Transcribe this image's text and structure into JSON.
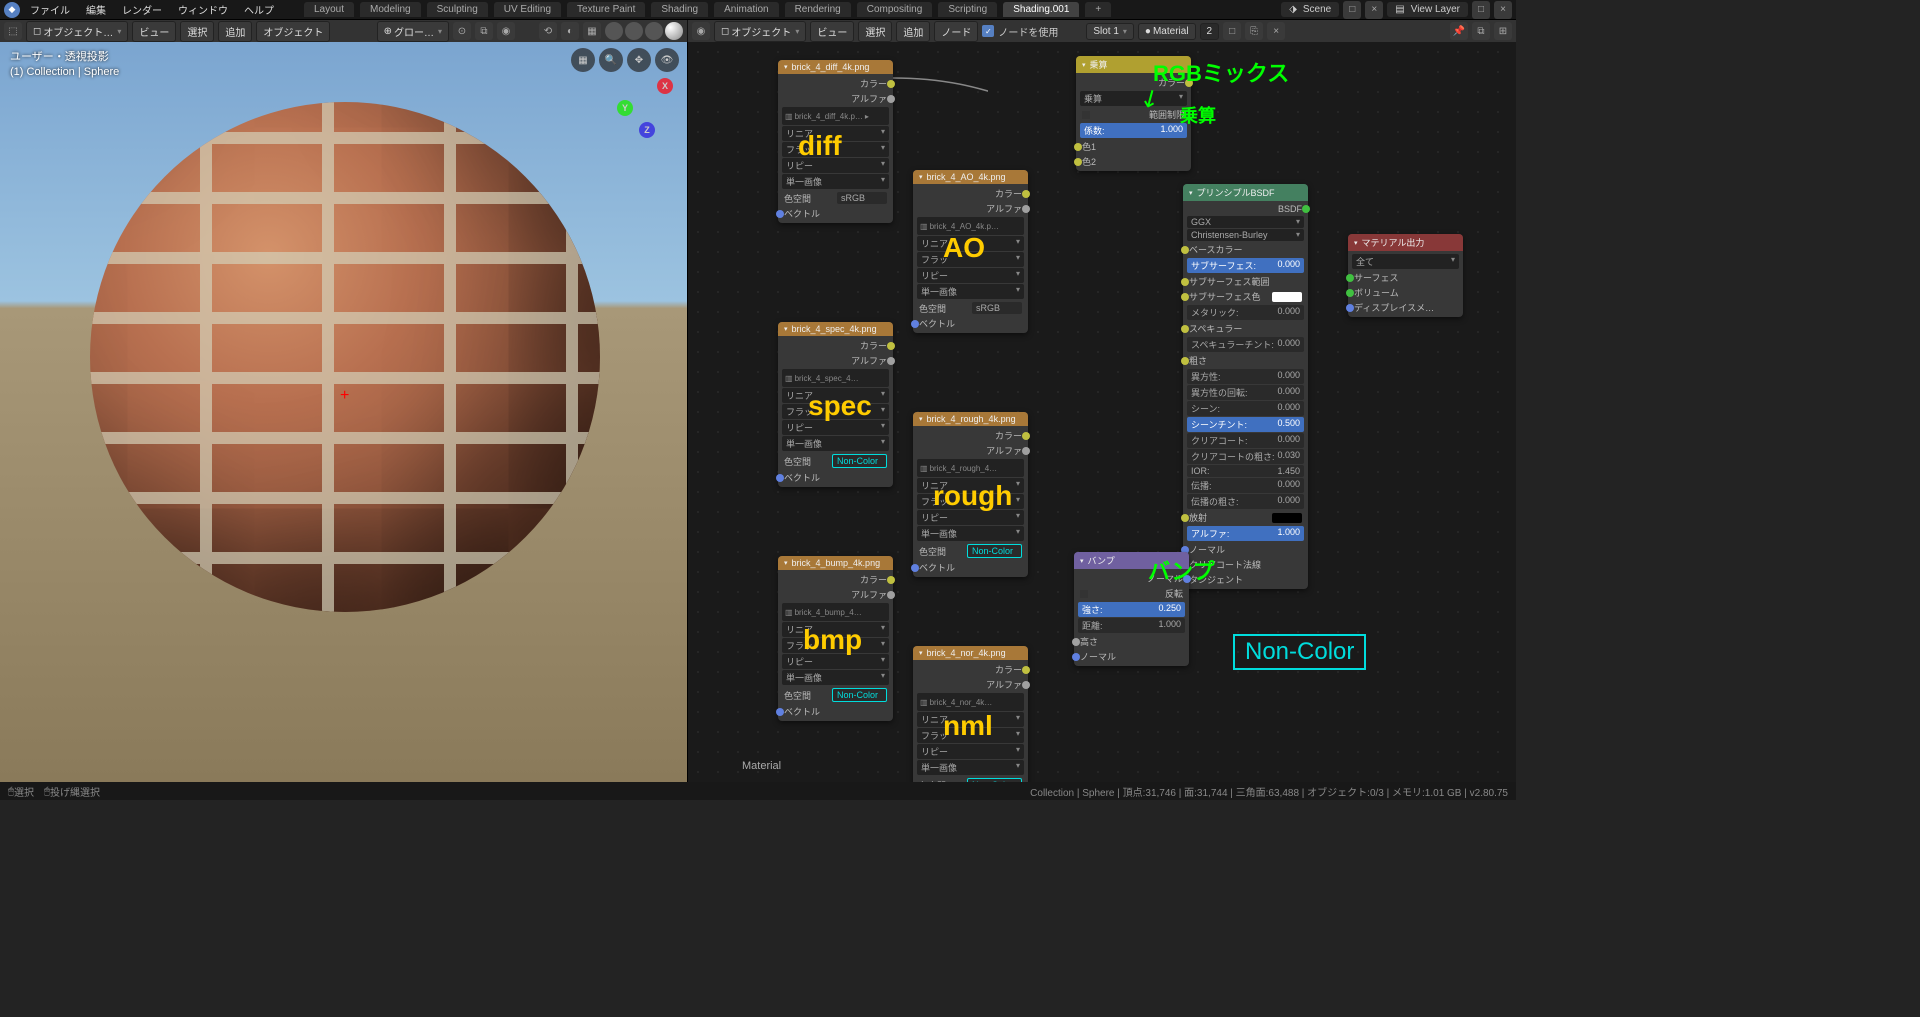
{
  "topbar": {
    "menus": [
      "ファイル",
      "編集",
      "レンダー",
      "ウィンドウ",
      "ヘルプ"
    ],
    "tabs": [
      "Layout",
      "Modeling",
      "Sculpting",
      "UV Editing",
      "Texture Paint",
      "Shading",
      "Animation",
      "Rendering",
      "Compositing",
      "Scripting",
      "Shading.001"
    ],
    "active_tab": "Shading.001",
    "scene_label": "Scene",
    "viewlayer_label": "View Layer"
  },
  "header_left": {
    "mode": "オブジェクト…",
    "menus": [
      "ビュー",
      "選択",
      "追加",
      "オブジェクト"
    ],
    "orient": "グロー…"
  },
  "header_right": {
    "mode": "オブジェクト",
    "menus": [
      "ビュー",
      "選択",
      "追加",
      "ノード"
    ],
    "use_nodes": "ノードを使用",
    "slot": "Slot 1",
    "material": "Material",
    "mat_users": "2"
  },
  "viewport": {
    "line1": "ユーザー・透視投影",
    "line2": "(1) Collection | Sphere"
  },
  "nodes": {
    "diff": {
      "title": "brick_4_diff_4k.png",
      "file": "brick_4_diff_4k.p…",
      "out_color": "カラー",
      "out_alpha": "アルファ",
      "interp": "リニア",
      "proj": "フラッ",
      "ext": "リピー",
      "single": "単一画像",
      "cs_label": "色空間",
      "cs": "sRGB",
      "vec": "ベクトル"
    },
    "ao": {
      "title": "brick_4_AO_4k.png",
      "file": "brick_4_AO_4k.p…",
      "cs": "sRGB"
    },
    "spec": {
      "title": "brick_4_spec_4k.png",
      "file": "brick_4_spec_4…",
      "cs": "Non-Color"
    },
    "rough": {
      "title": "brick_4_rough_4k.png",
      "file": "brick_4_rough_4…",
      "cs": "Non-Color"
    },
    "bmp": {
      "title": "brick_4_bump_4k.png",
      "file": "brick_4_bump_4…",
      "cs": "Non-Color"
    },
    "nml": {
      "title": "brick_4_nor_4k.png",
      "file": "brick_4_nor_4k…",
      "cs": "Non-Color"
    },
    "mix": {
      "title": "乗算",
      "out": "カラー",
      "blend": "乗算",
      "clamp": "範囲制限",
      "fac_l": "係数:",
      "fac": "1.000",
      "c1": "色1",
      "c2": "色2"
    },
    "bsdf": {
      "title": "プリンシプルBSDF",
      "out": "BSDF",
      "dist": "GGX",
      "sss": "Christensen-Burley",
      "rows": [
        [
          "ベースカラー",
          ""
        ],
        [
          "サブサーフェス:",
          "0.000"
        ],
        [
          "サブサーフェス範囲",
          ""
        ],
        [
          "サブサーフェス色",
          ""
        ],
        [
          "メタリック:",
          "0.000"
        ],
        [
          "スペキュラー",
          ""
        ],
        [
          "スペキュラーチント:",
          "0.000"
        ],
        [
          "粗さ",
          ""
        ],
        [
          "異方性:",
          "0.000"
        ],
        [
          "異方性の回転:",
          "0.000"
        ],
        [
          "シーン:",
          "0.000"
        ],
        [
          "シーンチント:",
          "0.500"
        ],
        [
          "クリアコート:",
          "0.000"
        ],
        [
          "クリアコートの粗さ:",
          "0.030"
        ],
        [
          "IOR:",
          "1.450"
        ],
        [
          "伝播:",
          "0.000"
        ],
        [
          "伝播の粗さ:",
          "0.000"
        ],
        [
          "放射",
          ""
        ],
        [
          "アルファ:",
          "1.000"
        ],
        [
          "ノーマル",
          ""
        ],
        [
          "クリアコート法線",
          ""
        ],
        [
          "タンジェント",
          ""
        ]
      ]
    },
    "bump": {
      "title": "バンプ",
      "out": "ノーマル",
      "invert": "反転",
      "str_l": "強さ:",
      "str": "0.250",
      "dist_l": "距離:",
      "dist": "1.000",
      "height": "高さ",
      "normal": "ノーマル"
    },
    "output": {
      "title": "マテリアル出力",
      "all": "全て",
      "surf": "サーフェス",
      "vol": "ボリューム",
      "disp": "ディスプレイスメ…"
    }
  },
  "annotations": {
    "diff": "diff",
    "ao": "AO",
    "spec": "spec",
    "rough": "rough",
    "bmp": "bmp",
    "nml": "nml",
    "rgbmix": "RGBミックス",
    "mult": "乗算",
    "bump": "バンプ",
    "noncolor": "Non-Color"
  },
  "node_material_label": "Material",
  "statusbar": {
    "left_sel": "選択",
    "left_lasso": "投げ縄選択",
    "right": "Collection | Sphere | 頂点:31,746 | 面:31,744 | 三角面:63,488 | オブジェクト:0/3 | メモリ:1.01 GB | v2.80.75"
  }
}
